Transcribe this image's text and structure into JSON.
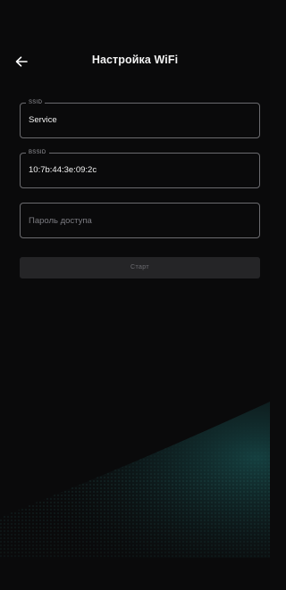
{
  "header": {
    "title": "Настройка WiFi",
    "back_icon": "arrow-left-icon"
  },
  "fields": {
    "ssid": {
      "label": "SSID",
      "value": "Service"
    },
    "bssid": {
      "label": "BSSID",
      "value": "10:7b:44:3e:09:2c"
    },
    "password": {
      "placeholder": "Пароль доступа",
      "value": ""
    }
  },
  "start_button": {
    "label": "Старт",
    "enabled": false
  },
  "colors": {
    "background": "#0a0a0b",
    "field_border": "#6b6b6f",
    "button_bg": "#252527",
    "button_text": "#6d6d72",
    "accent_wave": "#1e6a6a"
  }
}
